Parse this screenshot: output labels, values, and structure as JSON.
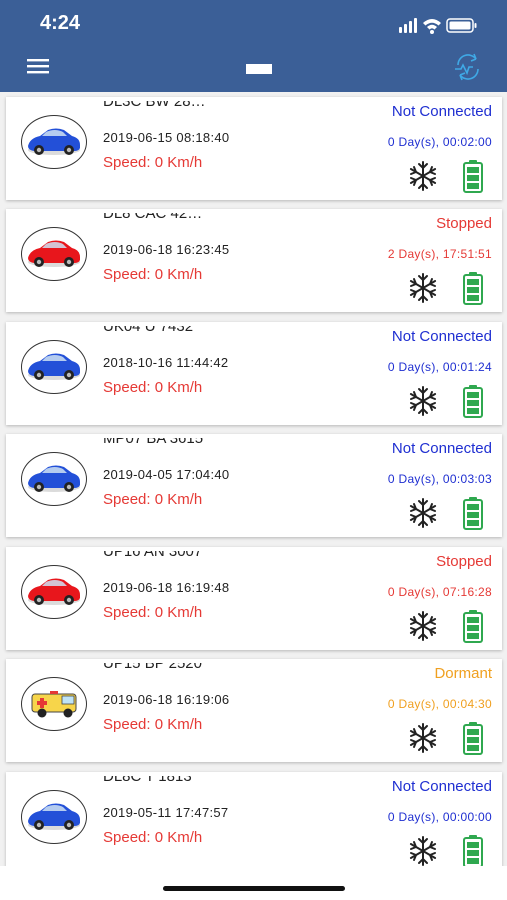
{
  "status_bar": {
    "time": "4:24"
  },
  "header": {
    "menu_icon": "hamburger-menu-icon",
    "refresh_icon": "refresh-icon"
  },
  "colors": {
    "header_bg": "#3b5f97",
    "not_connected": "#1f2fd1",
    "stopped": "#e53935",
    "dormant": "#f0a020",
    "speed": "#e53935",
    "battery": "#2fa84f"
  },
  "vehicles": [
    {
      "reg": "DL3C BW 28…",
      "datetime": "2019-06-15 08:18:40",
      "speed": "Speed: 0 Km/h",
      "status": "Not Connected",
      "duration": "0 Day(s), 00:02:00",
      "status_type": "not_connected",
      "icon": "blue-car-icon"
    },
    {
      "reg": "DL8 CAC 42…",
      "datetime": "2019-06-18 16:23:45",
      "speed": "Speed: 0 Km/h",
      "status": "Stopped",
      "duration": "2 Day(s), 17:51:51",
      "status_type": "stopped",
      "icon": "red-car-icon"
    },
    {
      "reg": "UK04 U 7432",
      "datetime": "2018-10-16 11:44:42",
      "speed": "Speed: 0 Km/h",
      "status": "Not Connected",
      "duration": "0 Day(s), 00:01:24",
      "status_type": "not_connected",
      "icon": "blue-car-icon"
    },
    {
      "reg": "MP07 BA 3615",
      "datetime": "2019-04-05 17:04:40",
      "speed": "Speed: 0 Km/h",
      "status": "Not Connected",
      "duration": "0 Day(s), 00:03:03",
      "status_type": "not_connected",
      "icon": "blue-car-icon"
    },
    {
      "reg": "UP16 AN 3007",
      "datetime": "2019-06-18 16:19:48",
      "speed": "Speed: 0 Km/h",
      "status": "Stopped",
      "duration": "0 Day(s), 07:16:28",
      "status_type": "stopped",
      "icon": "red-car-icon"
    },
    {
      "reg": "UP15 BP 2520",
      "datetime": "2019-06-18 16:19:06",
      "speed": "Speed: 0 Km/h",
      "status": "Dormant",
      "duration": "0 Day(s), 00:04:30",
      "status_type": "dormant",
      "icon": "ambulance-icon"
    },
    {
      "reg": "DL8C T 1813",
      "datetime": "2019-05-11 17:47:57",
      "speed": "Speed: 0 Km/h",
      "status": "Not Connected",
      "duration": "0 Day(s), 00:00:00",
      "status_type": "not_connected",
      "icon": "blue-car-icon"
    }
  ]
}
